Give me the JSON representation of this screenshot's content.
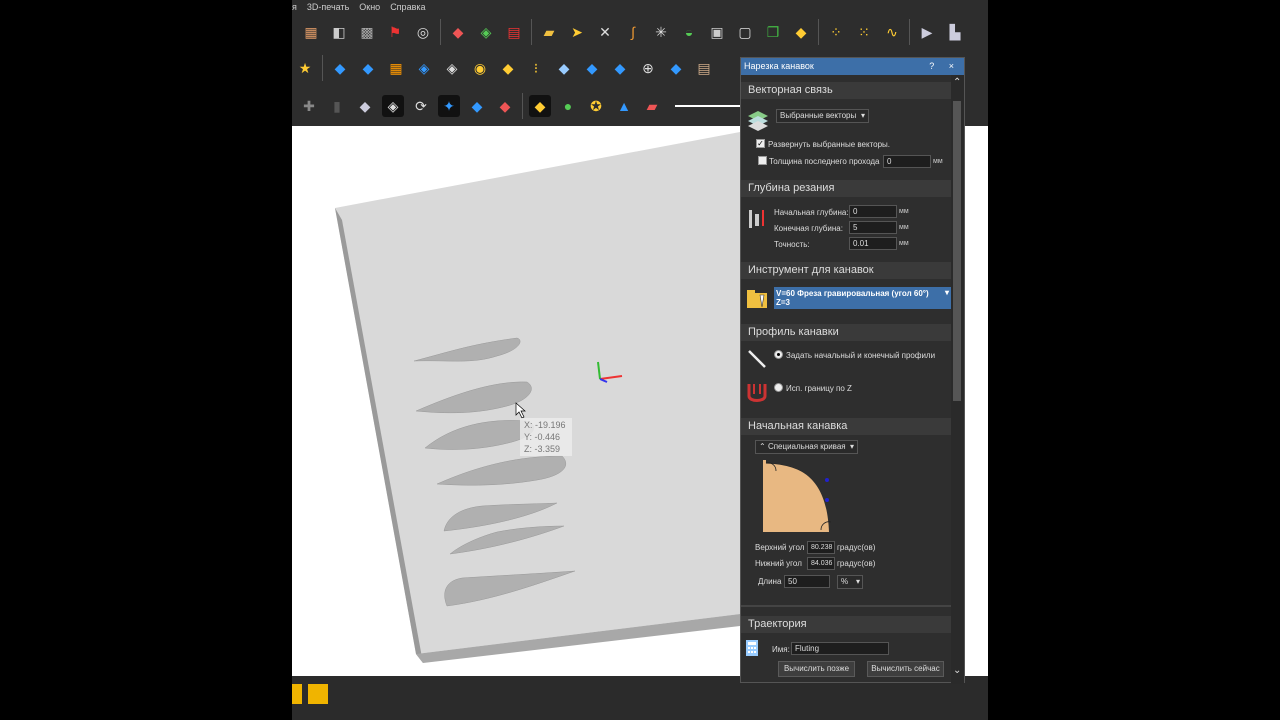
{
  "menu": [
    "я",
    "3D-печать",
    "Окно",
    "Справка"
  ],
  "viewport": {
    "coords": {
      "x": "X: -19.196",
      "y": "Y: -0.446",
      "z": "Z: -3.359"
    }
  },
  "panel": {
    "title": "Нарезка канавок",
    "title_buttons": "? ×",
    "vector": {
      "header": "Векторная связь",
      "select_value": "Выбранные векторы",
      "expand_label": "Развернуть выбранные векторы.",
      "expand_checked": true,
      "last_pass_label": "Толщина последнего прохода",
      "last_pass_value": "0",
      "last_pass_unit": "мм"
    },
    "depth": {
      "header": "Глубина резания",
      "start_label": "Начальная глубина:",
      "start_value": "0",
      "end_label": "Конечная глубина:",
      "end_value": "5",
      "accuracy_label": "Точность:",
      "accuracy_value": "0.01",
      "unit": "мм"
    },
    "tool": {
      "header": "Инструмент для канавок",
      "name_line1": "V=60 Фреза гравировальная (угол 60°)",
      "name_line2": "Z=3"
    },
    "profile": {
      "header": "Профиль канавки",
      "option1": "Задать начальный и конечный профили",
      "option2": "Исп. границу по Z"
    },
    "start_groove": {
      "header": "Начальная канавка",
      "curve_type": "Специальная кривая",
      "top_angle_label": "Верхний угол",
      "top_angle_value": "80.238",
      "bottom_angle_label": "Нижний угол",
      "bottom_angle_value": "84.036",
      "angle_unit": "градус(ов)",
      "length_label": "Длина",
      "length_value": "50",
      "length_unit": "%"
    },
    "toolpath": {
      "header": "Траектория",
      "name_label": "Имя:",
      "name_value": "Fluting",
      "calc_later": "Вычислить позже",
      "calc_now": "Вычислить сейчас"
    }
  },
  "colors": {
    "panel_title": "#3d6fa8",
    "panel_bg": "#2e2e2e",
    "selected_tool": "#3d6fa8",
    "accent": "#f0b400"
  }
}
